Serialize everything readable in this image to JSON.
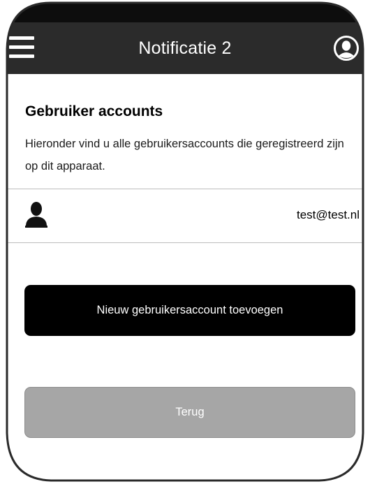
{
  "header": {
    "title": "Notificatie 2",
    "menu_icon": "hamburger-menu-icon",
    "profile_icon": "user-circle-icon"
  },
  "accounts_section": {
    "title": "Gebruiker accounts",
    "description": "Hieronder vind u alle gebruikersaccounts die geregistreerd zijn op dit apparaat."
  },
  "accounts": [
    {
      "icon": "person-icon",
      "email": "test@test.nl"
    }
  ],
  "actions": {
    "add_account_label": "Nieuw gebruikersaccount toevoegen",
    "back_label": "Terug"
  },
  "colors": {
    "app_bar": "#2b2b2b",
    "primary_button": "#000000",
    "back_button": "#a6a6a6",
    "divider": "#bdbdbd"
  }
}
